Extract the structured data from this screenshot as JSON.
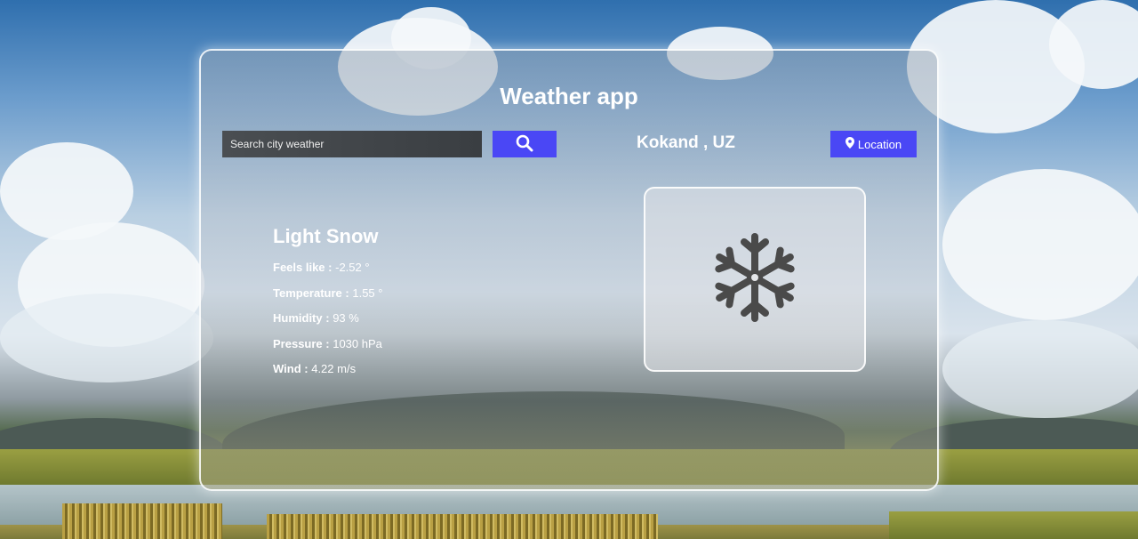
{
  "app": {
    "title": "Weather app"
  },
  "search": {
    "placeholder": "Search city weather",
    "button_icon": "search-icon"
  },
  "location": {
    "city_label": "Kokand , UZ",
    "button_label": "Location",
    "button_icon": "map-marker-icon"
  },
  "weather": {
    "condition": "Light Snow",
    "icon": "snowflake-icon",
    "details": [
      {
        "label": "Feels like :",
        "value": "-2.52 °"
      },
      {
        "label": "Temperature :",
        "value": "1.55 °"
      },
      {
        "label": "Humidity :",
        "value": "93 %"
      },
      {
        "label": "Pressure :",
        "value": "1030 hPa"
      },
      {
        "label": "Wind :",
        "value": "4.22 m/s"
      }
    ]
  },
  "colors": {
    "accent": "#4a47f5",
    "text": "#ffffff",
    "icon": "#4a4a4a"
  }
}
